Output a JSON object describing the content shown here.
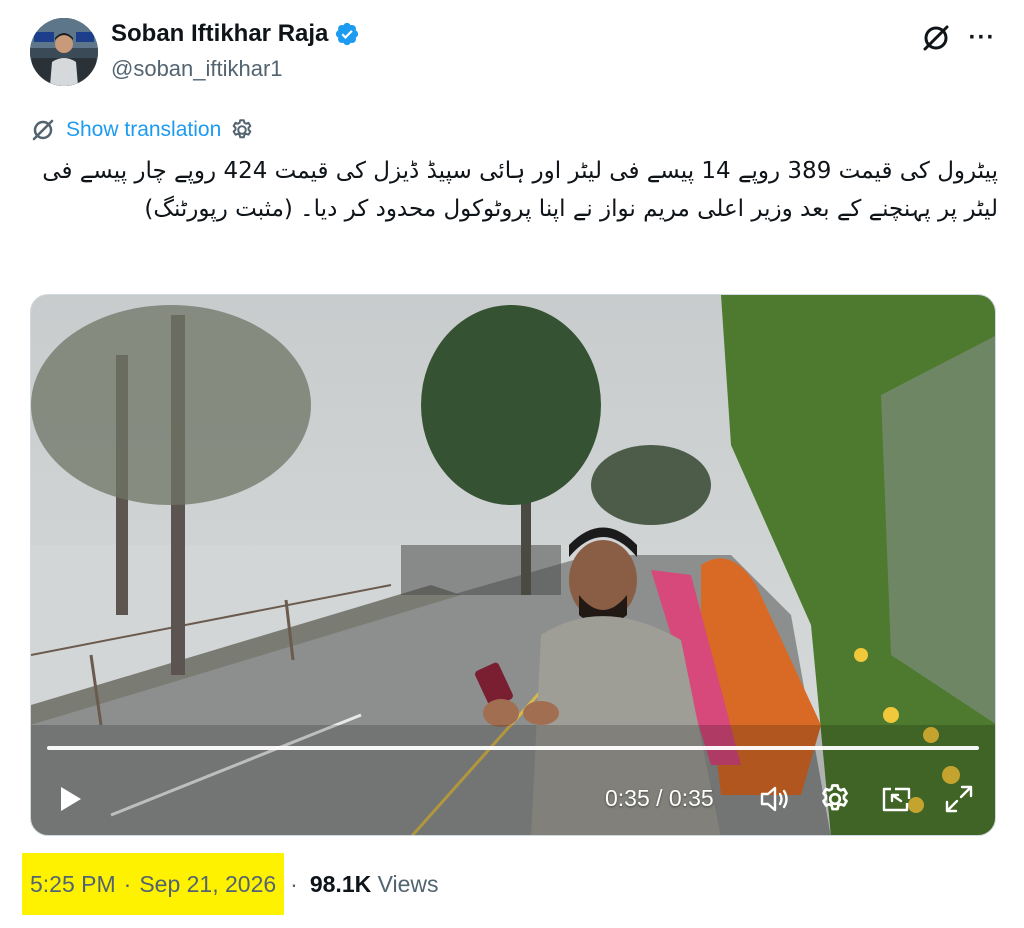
{
  "author": {
    "display_name": "Soban Iftikhar Raja",
    "handle": "@soban_iftikhar1",
    "verified": true
  },
  "header_actions": {
    "grok_icon": "grok-icon",
    "more_label": "···"
  },
  "translation": {
    "link_label": "Show translation"
  },
  "tweet": {
    "text": "پیٹرول کی قیمت 389 روپے 14 پیسے فی لیٹر اور ہائی سپیڈ ڈیزل کی قیمت 424 روپے چار پیسے فی لیٹر پر پہنچنے کے بعد وزیر اعلی مریم نواز نے اپنا پروٹوکول محدود کر دیا۔ (مثبت رپورٹنگ)"
  },
  "video": {
    "time_display": "0:35 / 0:35",
    "progress": 1.0
  },
  "meta": {
    "time": "5:25 PM",
    "separator": "·",
    "date": "Sep 21, 2026",
    "views_count": "98.1K",
    "views_label": "Views"
  },
  "colors": {
    "accent": "#1d9bf0",
    "highlight": "#fff200",
    "secondary_text": "#536471"
  }
}
